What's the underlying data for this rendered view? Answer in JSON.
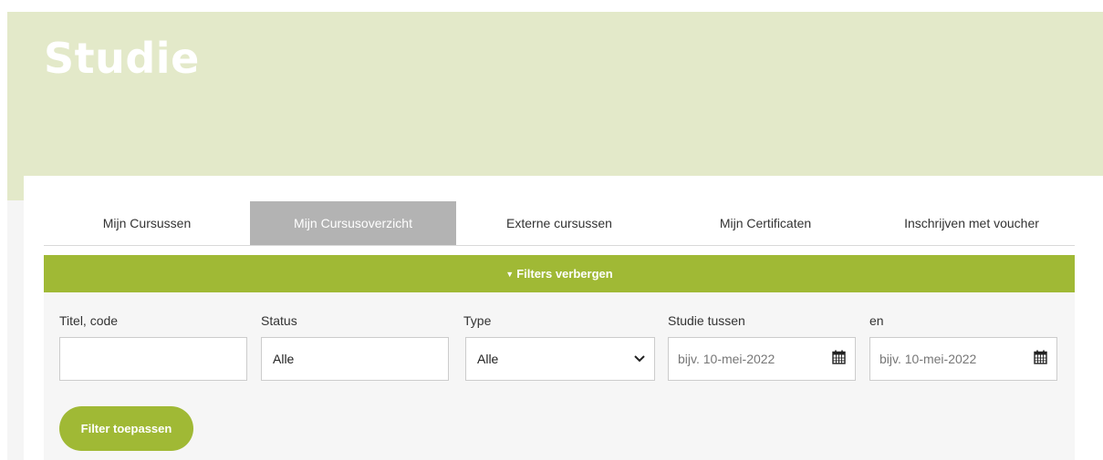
{
  "page": {
    "title": "Studie"
  },
  "tabs": [
    {
      "label": "Mijn Cursussen"
    },
    {
      "label": "Mijn Cursusoverzicht",
      "active": true
    },
    {
      "label": "Externe cursussen"
    },
    {
      "label": "Mijn Certificaten"
    },
    {
      "label": "Inschrijven met voucher"
    }
  ],
  "filter_toggle": {
    "label": "Filters verbergen",
    "icon": "caret-down-icon"
  },
  "filters": {
    "title": {
      "label": "Titel, code",
      "value": ""
    },
    "status": {
      "label": "Status",
      "value": "Alle"
    },
    "type": {
      "label": "Type",
      "value": "Alle",
      "icon": "chevron-down-icon"
    },
    "date_from": {
      "label": "Studie tussen",
      "placeholder": "bijv. 10-mei-2022",
      "icon": "calendar-icon"
    },
    "date_to": {
      "label": "en",
      "placeholder": "bijv. 10-mei-2022",
      "icon": "calendar-icon"
    }
  },
  "apply_button": {
    "label": "Filter toepassen"
  },
  "colors": {
    "brand_green": "#a0b935",
    "hero_bg": "#e3e9c9",
    "active_tab": "#b3b3b3"
  }
}
